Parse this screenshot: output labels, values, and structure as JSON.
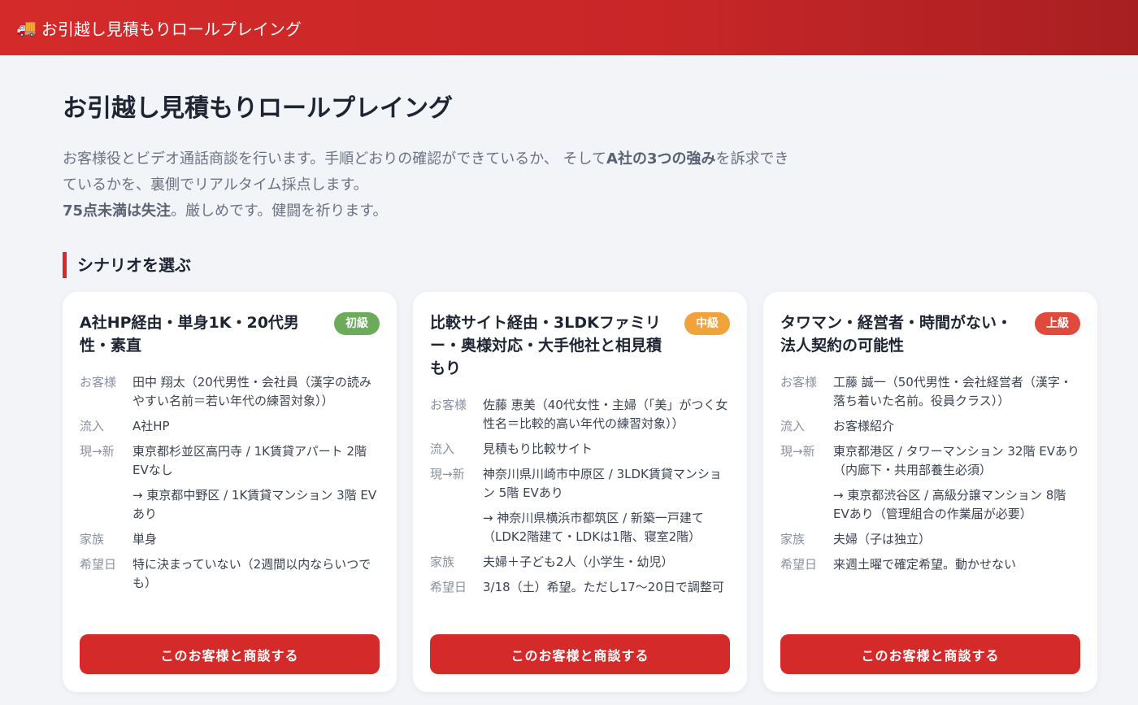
{
  "header": {
    "icon": "truck-icon",
    "title": "お引越し見積もりロールプレイング"
  },
  "main": {
    "title": "お引越し見積もりロールプレイング",
    "intro": {
      "line1_a": "お客様役とビデオ通話商談を行います。手順どおりの確認ができているか、 そして",
      "line1_b": "A社の3つの強み",
      "line1_c": "を訴求できているかを、裏側でリアルタイム採点します。",
      "line2_a": "75点未満は失注",
      "line2_b": "。厳しめです。健闘を祈ります。"
    },
    "section_title": "シナリオを選ぶ"
  },
  "labels": {
    "customer": "お客様",
    "source": "流入",
    "move": "現→新",
    "family": "家族",
    "date": "希望日"
  },
  "colors": {
    "beginner": "#6bab5a",
    "intermediate": "#f0a33a",
    "advanced": "#e04a3c",
    "accent": "#d42a2a"
  },
  "scenarios": [
    {
      "title": "A社HP経由・単身1K・20代男性・素直",
      "level": "初級",
      "customer": "田中 翔太（20代男性・会社員（漢字の読みやすい名前＝若い年代の練習対象））",
      "source": "A社HP",
      "from": "東京都杉並区高円寺 / 1K賃貸アパート 2階 EVなし",
      "to": "→ 東京都中野区 / 1K賃貸マンション 3階 EVあり",
      "family": "単身",
      "date": "特に決まっていない（2週間以内ならいつでも）",
      "button": "このお客様と商談する"
    },
    {
      "title": "比較サイト経由・3LDKファミリー・奥様対応・大手他社と相見積もり",
      "level": "中級",
      "customer": "佐藤 恵美（40代女性・主婦（「美」がつく女性名＝比較的高い年代の練習対象））",
      "source": "見積もり比較サイト",
      "from": "神奈川県川崎市中原区 / 3LDK賃貸マンション 5階 EVあり",
      "to": "→ 神奈川県横浜市都筑区 / 新築一戸建て（LDK2階建て・LDKは1階、寝室2階）",
      "family": "夫婦＋子ども2人（小学生・幼児）",
      "date": "3/18（土）希望。ただし17〜20日で調整可",
      "button": "このお客様と商談する"
    },
    {
      "title": "タワマン・経営者・時間がない・法人契約の可能性",
      "level": "上級",
      "customer": "工藤 誠一（50代男性・会社経営者（漢字・落ち着いた名前。役員クラス））",
      "source": "お客様紹介",
      "from": "東京都港区 / タワーマンション 32階 EVあり（内廊下・共用部養生必須）",
      "to": "→ 東京都渋谷区 / 高級分譲マンション 8階 EVあり（管理組合の作業届が必要）",
      "family": "夫婦（子は独立）",
      "date": "来週土曜で確定希望。動かせない",
      "button": "このお客様と商談する"
    }
  ]
}
